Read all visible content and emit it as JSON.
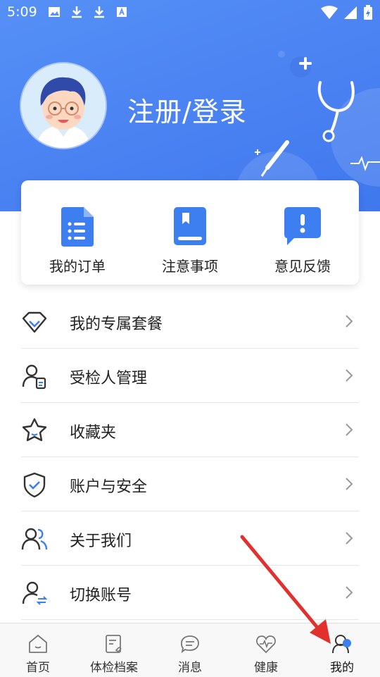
{
  "status_bar": {
    "time": "5:09"
  },
  "profile": {
    "login_text": "注册/登录"
  },
  "quick_actions": [
    {
      "label": "我的订单",
      "icon": "order-list-icon"
    },
    {
      "label": "注意事项",
      "icon": "notes-book-icon"
    },
    {
      "label": "意见反馈",
      "icon": "feedback-icon"
    }
  ],
  "menu": [
    {
      "label": "我的专属套餐",
      "icon": "diamond-icon"
    },
    {
      "label": "受检人管理",
      "icon": "examinee-icon"
    },
    {
      "label": "收藏夹",
      "icon": "star-icon"
    },
    {
      "label": "账户与安全",
      "icon": "shield-icon"
    },
    {
      "label": "关于我们",
      "icon": "about-users-icon"
    },
    {
      "label": "切换账号",
      "icon": "switch-account-icon"
    }
  ],
  "tabs": [
    {
      "label": "首页",
      "icon": "home-icon"
    },
    {
      "label": "体检档案",
      "icon": "record-icon"
    },
    {
      "label": "消息",
      "icon": "message-icon"
    },
    {
      "label": "健康",
      "icon": "health-icon"
    },
    {
      "label": "我的",
      "icon": "profile-icon",
      "active": true
    }
  ],
  "colors": {
    "primary": "#4a82f2",
    "accent": "#3d7ff0",
    "arrow": "#e0312f"
  }
}
